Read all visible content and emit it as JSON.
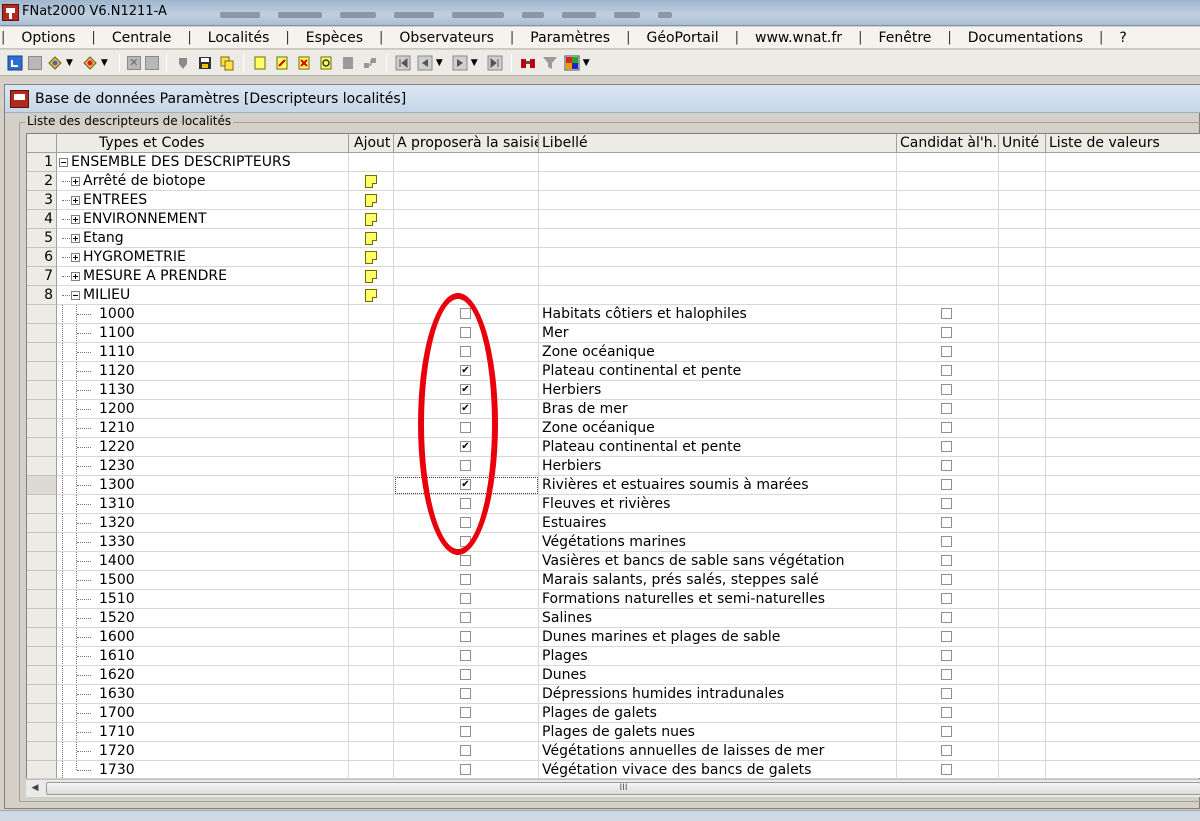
{
  "app": {
    "title": "FNat2000 V6.N1211-A"
  },
  "menu": [
    "Options",
    "Centrale",
    "Localités",
    "Espèces",
    "Observateurs",
    "Paramètres",
    "GéoPortail",
    "www.wnat.fr",
    "Fenêtre",
    "Documentations",
    "?"
  ],
  "toolbar": {
    "icons": [
      "refresh-icon",
      "stop-icon",
      "map-dropdown-icon",
      "compass-dropdown-icon",
      "close-x-icon",
      "gray-icon",
      "pin-icon",
      "save-icon",
      "copy-icon",
      "new-note-icon",
      "edit-note-icon",
      "delete-note-icon",
      "search-note-icon",
      "doc-icon",
      "tree-icon",
      "first-icon",
      "prev-icon",
      "next-icon",
      "last-icon",
      "binoculars-icon",
      "filter-icon",
      "grid-icon"
    ]
  },
  "window": {
    "title": "Base de données Paramètres [Descripteurs localités]"
  },
  "group": {
    "label": "Liste des descripteurs de localités"
  },
  "grid": {
    "columns": [
      "Types et Codes",
      "Ajout",
      "A proposerà la saisie",
      "Libellé",
      "Candidat àl'h...",
      "Unité",
      "Liste de valeurs"
    ],
    "parents": [
      {
        "num": "1",
        "label": "ENSEMBLE DES DESCRIPTEURS",
        "expanded": true,
        "note": false
      },
      {
        "num": "2",
        "label": "Arrêté de biotope",
        "expanded": false,
        "note": true
      },
      {
        "num": "3",
        "label": "ENTREES",
        "expanded": false,
        "note": true
      },
      {
        "num": "4",
        "label": "ENVIRONNEMENT",
        "expanded": false,
        "note": true
      },
      {
        "num": "5",
        "label": "Etang",
        "expanded": false,
        "note": true
      },
      {
        "num": "6",
        "label": "HYGROMETRIE",
        "expanded": false,
        "note": true
      },
      {
        "num": "7",
        "label": "MESURE A PRENDRE",
        "expanded": false,
        "note": true
      },
      {
        "num": "8",
        "label": "MILIEU",
        "expanded": true,
        "note": true
      }
    ],
    "children": [
      {
        "code": "1000",
        "propose": false,
        "libelle": "Habitats côtiers et halophiles",
        "candidat": false
      },
      {
        "code": "1100",
        "propose": false,
        "libelle": "Mer",
        "candidat": false
      },
      {
        "code": "1110",
        "propose": false,
        "libelle": "Zone océanique",
        "candidat": false
      },
      {
        "code": "1120",
        "propose": true,
        "libelle": "Plateau continental et pente",
        "candidat": false
      },
      {
        "code": "1130",
        "propose": true,
        "libelle": "Herbiers",
        "candidat": false
      },
      {
        "code": "1200",
        "propose": true,
        "libelle": "Bras de mer",
        "candidat": false
      },
      {
        "code": "1210",
        "propose": false,
        "libelle": "Zone océanique",
        "candidat": false
      },
      {
        "code": "1220",
        "propose": true,
        "libelle": "Plateau continental et pente",
        "candidat": false
      },
      {
        "code": "1230",
        "propose": false,
        "libelle": "Herbiers",
        "candidat": false
      },
      {
        "code": "1300",
        "propose": true,
        "libelle": "Rivières et estuaires soumis à marées",
        "candidat": false,
        "selected": true
      },
      {
        "code": "1310",
        "propose": false,
        "libelle": "Fleuves et rivières",
        "candidat": false
      },
      {
        "code": "1320",
        "propose": false,
        "libelle": "Estuaires",
        "candidat": false
      },
      {
        "code": "1330",
        "propose": false,
        "libelle": "Végétations marines",
        "candidat": false
      },
      {
        "code": "1400",
        "propose": false,
        "libelle": "Vasières et bancs de sable sans végétation",
        "candidat": false
      },
      {
        "code": "1500",
        "propose": false,
        "libelle": "Marais salants, prés salés, steppes salé",
        "candidat": false
      },
      {
        "code": "1510",
        "propose": false,
        "libelle": "Formations naturelles et semi-naturelles",
        "candidat": false
      },
      {
        "code": "1520",
        "propose": false,
        "libelle": "Salines",
        "candidat": false
      },
      {
        "code": "1600",
        "propose": false,
        "libelle": "Dunes marines et plages de sable",
        "candidat": false
      },
      {
        "code": "1610",
        "propose": false,
        "libelle": "Plages",
        "candidat": false
      },
      {
        "code": "1620",
        "propose": false,
        "libelle": "Dunes",
        "candidat": false
      },
      {
        "code": "1630",
        "propose": false,
        "libelle": "Dépressions humides intradunales",
        "candidat": false
      },
      {
        "code": "1700",
        "propose": false,
        "libelle": "Plages de galets",
        "candidat": false
      },
      {
        "code": "1710",
        "propose": false,
        "libelle": "Plages de galets nues",
        "candidat": false
      },
      {
        "code": "1720",
        "propose": false,
        "libelle": "Végétations annuelles de laisses de mer",
        "candidat": false
      },
      {
        "code": "1730",
        "propose": false,
        "libelle": "Végétation vivace des bancs de galets",
        "candidat": false
      }
    ]
  },
  "scrollbar": {
    "thumb_grip": "III"
  },
  "colors": {
    "annotation": "#e8000d",
    "note": "#ffff66"
  }
}
